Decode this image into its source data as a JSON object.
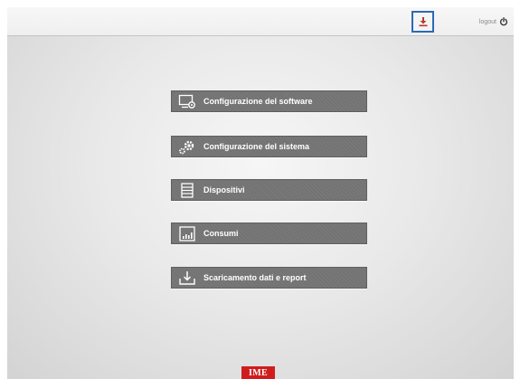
{
  "topbar": {
    "download_icon": "download-icon",
    "logout_label": "logout",
    "logout_icon": "power-icon"
  },
  "menu": {
    "items": [
      {
        "label": "Configurazione del software",
        "icon": "software-config-icon"
      },
      {
        "label": "Configurazione del sistema",
        "icon": "gears-icon"
      },
      {
        "label": "Dispositivi",
        "icon": "devices-icon"
      },
      {
        "label": "Consumi",
        "icon": "chart-icon"
      },
      {
        "label": "Scaricamento dati e report",
        "icon": "download-tray-icon"
      }
    ]
  },
  "footer": {
    "brand": "IME"
  },
  "colors": {
    "button_bg": "#737373",
    "highlight_border": "#2c69b7",
    "download_icon": "#b53a2a",
    "brand_bg": "#cf1d1d"
  }
}
